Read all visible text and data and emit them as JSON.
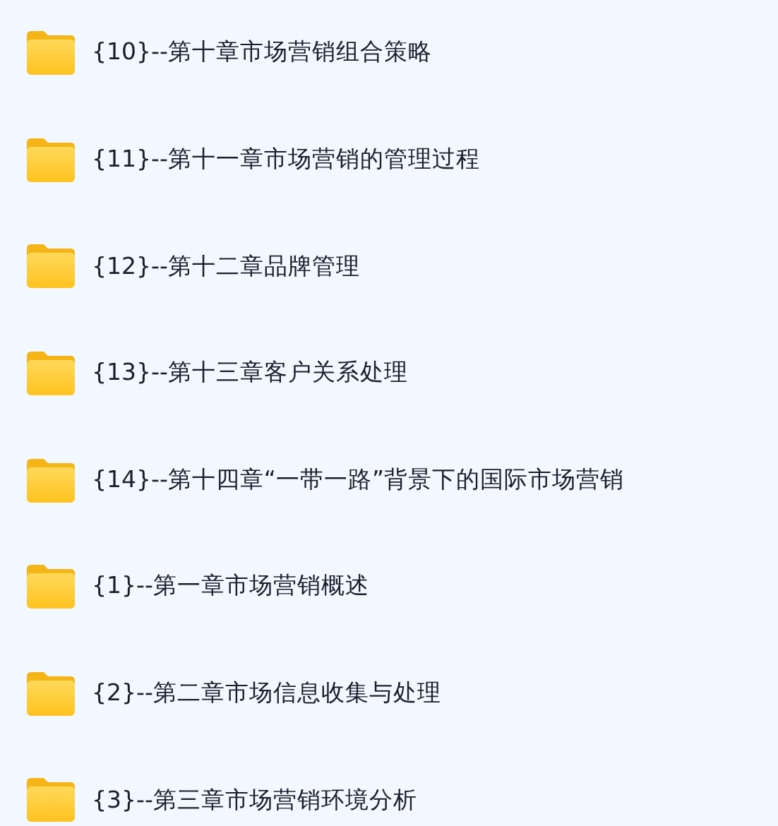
{
  "folders": [
    {
      "name": "{10}--第十章市场营销组合策略"
    },
    {
      "name": "{11}--第十一章市场营销的管理过程"
    },
    {
      "name": "{12}--第十二章品牌管理"
    },
    {
      "name": "{13}--第十三章客户关系处理"
    },
    {
      "name": "{14}--第十四章“一带一路”背景下的国际市场营销"
    },
    {
      "name": "{1}--第一章市场营销概述"
    },
    {
      "name": "{2}--第二章市场信息收集与处理"
    },
    {
      "name": "{3}--第三章市场营销环境分析"
    }
  ]
}
